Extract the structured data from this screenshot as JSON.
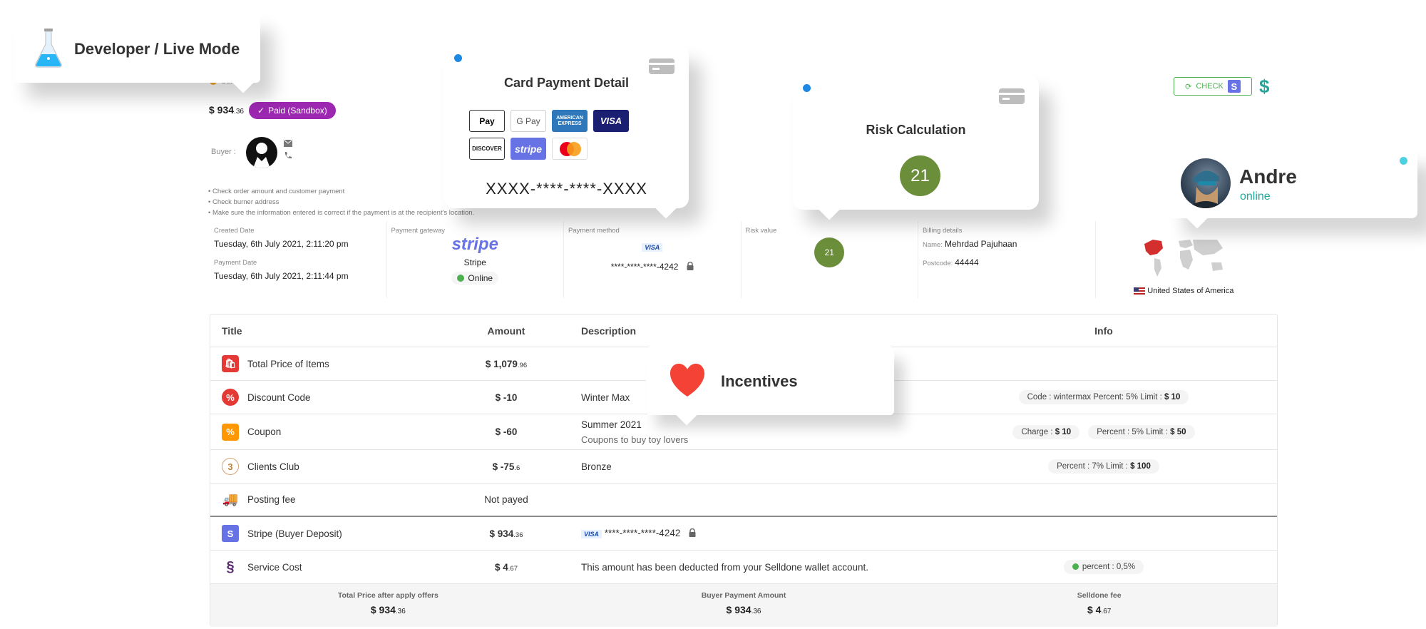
{
  "header": {
    "sub_label": "Sandbox",
    "price_whole": "$ 934",
    "price_cents": ".36",
    "paid_label": "Paid  (Sandbox)",
    "buyer_label": "Buyer :",
    "check_label": "CHECK",
    "notes": [
      "Check order amount and customer payment",
      "Check burner address",
      "Make sure the information entered is correct if the payment is at the recipient's location."
    ]
  },
  "info": {
    "created_label": "Created Date",
    "created_value": "Tuesday, 6th July 2021, 2:11:20 pm",
    "payment_date_label": "Payment Date",
    "payment_date_value": "Tuesday, 6th July 2021, 2:11:44 pm",
    "gateway_label": "Payment gateway",
    "gateway_logo": "stripe",
    "gateway_name": "Stripe",
    "gateway_status": "Online",
    "method_label": "Payment method",
    "method_brand": "VISA",
    "method_card": "****-****-****-4242",
    "risk_label": "Risk value",
    "risk_value": "21",
    "billing_label": "Billing details",
    "billing_name_label": "Name:",
    "billing_name": "Mehrdad Pajuhaan",
    "billing_post_label": "Postcode:",
    "billing_post": "44444",
    "country": "United States of America"
  },
  "table": {
    "headers": {
      "title": "Title",
      "amount": "Amount",
      "description": "Description",
      "info": "Info"
    },
    "rows": [
      {
        "title": "Total Price of Items",
        "amount": "$ 1,079",
        "cents": ".96",
        "desc": "",
        "icon": "shopping-bag-icon"
      },
      {
        "title": "Discount Code",
        "amount": "$ -10",
        "cents": "",
        "desc": "Winter Max",
        "icon": "discount-icon",
        "info": [
          {
            "k": "Code : wintermax  Percent: 5%  Limit :",
            "v": "$ 10"
          }
        ]
      },
      {
        "title": "Coupon",
        "amount": "$ -60",
        "cents": "",
        "desc": "Summer 2021",
        "desc_sub": "Coupons to buy toy lovers",
        "icon": "coupon-icon",
        "info": [
          {
            "k": "Charge :",
            "v": "$ 10"
          },
          {
            "k": "Percent : 5%   Limit :",
            "v": "$ 50"
          }
        ]
      },
      {
        "title": "Clients Club",
        "amount": "$ -75",
        "cents": ".6",
        "desc": "Bronze",
        "icon": "club-badge-icon",
        "info": [
          {
            "k": "Percent : 7%   Limit :",
            "v": "$ 100"
          }
        ]
      },
      {
        "title": "Posting fee",
        "amount": "Not payed",
        "cents": "",
        "desc": "",
        "icon": "delivery-truck-icon"
      },
      {
        "title": "Stripe (Buyer Deposit)",
        "amount": "$ 934",
        "cents": ".36",
        "desc_brand": "VISA",
        "desc": "****-****-****-4242",
        "icon": "stripe-icon"
      },
      {
        "title": "Service Cost",
        "amount": "$ 4",
        "cents": ".67",
        "desc": "This amount has been deducted from your Selldone wallet account.",
        "icon": "selldone-icon",
        "info": [
          {
            "k": "percent : 0,5%",
            "v": ""
          }
        ]
      }
    ],
    "footer": [
      {
        "label": "Total Price after apply offers",
        "value": "$ 934",
        "cents": ".36"
      },
      {
        "label": "Buyer Payment Amount",
        "value": "$ 934",
        "cents": ".36"
      },
      {
        "label": "Selldone fee",
        "value": "$ 4",
        "cents": ".67"
      }
    ]
  },
  "callouts": {
    "developer": "Developer / Live Mode",
    "card_payment_title": "Card Payment Detail",
    "card_mask": "XXXX-****-****-XXXX",
    "card_logos": [
      "Pay",
      "G Pay",
      "AMERICAN EXPRESS",
      "VISA",
      "DISCOVER",
      "stripe",
      ""
    ],
    "risk_title": "Risk Calculation",
    "risk_value": "21",
    "user_name": "Andre",
    "user_status": "online",
    "incentives": "Incentives"
  },
  "colors": {
    "paid_badge": "#9c27b0",
    "risk_green": "#6b8e3a",
    "stripe_purple": "#6772e5",
    "online_teal": "#26a69a"
  }
}
